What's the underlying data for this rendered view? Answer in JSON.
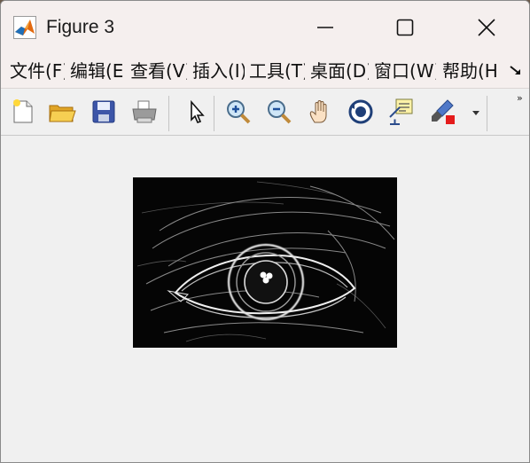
{
  "window": {
    "title": "Figure 3"
  },
  "menu": {
    "items": [
      {
        "label": "文件(F)"
      },
      {
        "label": "编辑(E)"
      },
      {
        "label": "查看(V)"
      },
      {
        "label": "插入(I)"
      },
      {
        "label": "工具(T)"
      },
      {
        "label": "桌面(D)"
      },
      {
        "label": "窗口(W)"
      },
      {
        "label": "帮助(H)"
      }
    ]
  },
  "toolbar": {
    "buttons": [
      {
        "icon": "new-figure-icon"
      },
      {
        "icon": "open-file-icon"
      },
      {
        "icon": "save-icon"
      },
      {
        "icon": "print-icon"
      },
      {
        "icon": "select-arrow-icon"
      },
      {
        "icon": "zoom-in-icon"
      },
      {
        "icon": "zoom-out-icon"
      },
      {
        "icon": "pan-hand-icon"
      },
      {
        "icon": "rotate-3d-icon"
      },
      {
        "icon": "data-cursor-icon"
      },
      {
        "icon": "brush-icon"
      }
    ],
    "overflow_label": "»"
  },
  "figure": {
    "image": "edge-detected-eye-icon"
  }
}
